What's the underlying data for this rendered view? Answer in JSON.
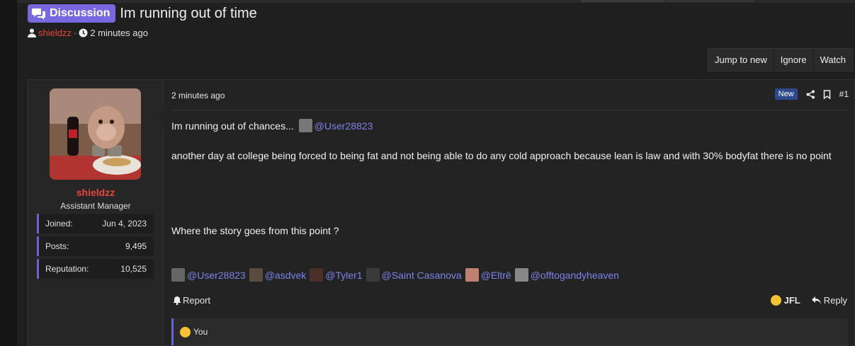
{
  "thread": {
    "prefix": "Discussion",
    "title": "Im running out of time",
    "author": "shieldzz",
    "separator": "·",
    "time": "2 minutes ago"
  },
  "thread_buttons": [
    "Jump to new",
    "Ignore",
    "Watch"
  ],
  "post": {
    "user": {
      "name": "shieldzz",
      "title": "Assistant Manager",
      "stats": [
        {
          "label": "Joined:",
          "value": "Jun 4, 2023"
        },
        {
          "label": "Posts:",
          "value": "9,495"
        },
        {
          "label": "Reputation:",
          "value": "10,525"
        }
      ]
    },
    "date": "2 minutes ago",
    "new_badge": "New",
    "number": "#1",
    "line1_text": "Im running out of chances...",
    "line1_mention": "@User28823",
    "paragraph": "another day at college being forced to being fat and not being able to do any cold approach because lean is law and with 30% bodyfat there is no point",
    "question": "Where the story goes from this point ?",
    "mentions": [
      "@User28823",
      "@asdvek",
      "@Tyler1",
      "@Saint Casanova",
      "@Eltrē",
      "@offtogandyheaven"
    ],
    "report_label": "Report",
    "jfl_label": "JFL",
    "reply_label": "Reply",
    "reaction_text": "You"
  },
  "colors": {
    "accent": "#7868e0",
    "username": "#e8463c",
    "mention": "#7b83e8",
    "new_badge": "#2f4a8c",
    "stat_border": "#6b62d6"
  }
}
